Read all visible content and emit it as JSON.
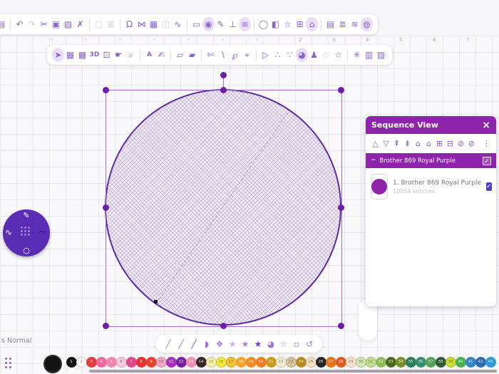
{
  "colors": {
    "accent": "#8e24aa",
    "toolbar_icon": "#8a63c9",
    "radial_bg": "#5b2db5",
    "circle_outline": "#5e2b9e",
    "selection": "#6d1fa7",
    "checkbox": "#4d3fc6"
  },
  "ruler": {
    "numbers": [
      "2",
      "3",
      "4",
      "5",
      "6",
      "7"
    ]
  },
  "status_text": "s Normal",
  "toolbar_top": {
    "items": [
      {
        "n": "save-icon",
        "g": "▤"
      },
      {
        "s": "sep"
      },
      {
        "n": "undo-icon",
        "g": "↶"
      },
      {
        "n": "redo-icon",
        "g": "↷",
        "s": "dis"
      },
      {
        "n": "cut-icon",
        "g": "✂"
      },
      {
        "n": "copy-icon",
        "g": "▣"
      },
      {
        "n": "paste-icon",
        "g": "▨"
      },
      {
        "n": "delete-icon",
        "g": "✗"
      },
      {
        "s": "sep"
      },
      {
        "n": "marquee-select-icon",
        "g": "▢",
        "s": "dis"
      },
      {
        "n": "transform-icon",
        "g": "⊞",
        "s": "dis"
      },
      {
        "s": "sep"
      },
      {
        "n": "magnet-icon",
        "g": "Ω"
      },
      {
        "n": "mirror-vertical-icon",
        "g": "⋈"
      },
      {
        "n": "machine-icon",
        "g": "▦"
      },
      {
        "n": "mirror-horizontal-icon",
        "g": "◫",
        "s": "dis"
      },
      {
        "n": "curve-icon",
        "g": "∿"
      },
      {
        "s": "sep"
      },
      {
        "n": "rectangle-icon",
        "g": "▭"
      },
      {
        "n": "reshape-icon",
        "g": "◉",
        "s": "hl"
      },
      {
        "n": "stitch-pen-icon",
        "g": "✎"
      },
      {
        "n": "pin-icon",
        "g": "⊥"
      },
      {
        "n": "stitch-params-icon",
        "g": "≡",
        "s": "hl"
      },
      {
        "s": "sep"
      },
      {
        "n": "hoop-icon",
        "g": "◯"
      },
      {
        "n": "shapes-icon",
        "g": "◧"
      },
      {
        "n": "frame-star-icon",
        "g": "☆"
      },
      {
        "n": "add-object-icon",
        "g": "⊞"
      },
      {
        "n": "lock-icon",
        "g": "⌂",
        "s": "hl"
      },
      {
        "s": "sep"
      },
      {
        "n": "design-list-icon",
        "g": "▤"
      },
      {
        "n": "properties-icon",
        "g": "≣"
      },
      {
        "n": "layers-icon",
        "g": "≋"
      },
      {
        "n": "globe-icon",
        "g": "◍",
        "s": "hl"
      }
    ]
  },
  "toolbar_tools": {
    "items": [
      {
        "n": "select-tool",
        "g": "➤",
        "s": "hl"
      },
      {
        "n": "mesh-select-tool",
        "g": "▦"
      },
      {
        "n": "lattice-select-tool",
        "g": "▩"
      },
      {
        "n": "view-3d-tool",
        "g": "3D",
        "c": "txt"
      },
      {
        "n": "monitor-tool",
        "g": "⊡"
      },
      {
        "n": "pan-tool",
        "g": "☛"
      },
      {
        "n": "zoom-tool",
        "g": "⌕"
      },
      {
        "s": "sep"
      },
      {
        "n": "lettering-tool",
        "g": "A",
        "c": "txt"
      },
      {
        "n": "monogram-tool",
        "g": "✍"
      },
      {
        "s": "sep"
      },
      {
        "n": "import-artwork-tool",
        "g": "▱"
      },
      {
        "n": "export-artwork-tool",
        "g": "▰"
      },
      {
        "s": "sep"
      },
      {
        "n": "knife-tool",
        "g": "✄"
      },
      {
        "n": "line-tool",
        "g": "∖"
      },
      {
        "n": "lasso-tool",
        "g": "℘"
      },
      {
        "n": "node-edit-tool",
        "g": "⌖"
      },
      {
        "s": "sep"
      },
      {
        "n": "run-tool",
        "g": "▷"
      },
      {
        "n": "stitch-nodes-tool",
        "g": "∴"
      },
      {
        "n": "outline-nodes-tool",
        "g": "∵"
      },
      {
        "n": "fill-tool",
        "g": "◕",
        "s": "hl"
      },
      {
        "n": "figure-tool",
        "g": "♟"
      },
      {
        "n": "shape-tool",
        "g": "◇",
        "s": "dis"
      },
      {
        "n": "star-tool",
        "g": "☆"
      },
      {
        "s": "sep"
      },
      {
        "n": "magic-wand-tool",
        "g": "✳"
      },
      {
        "n": "image-tool",
        "g": "▥"
      },
      {
        "n": "image-edit-tool",
        "g": "▨"
      }
    ]
  },
  "sequence_panel": {
    "title": "Sequence View",
    "close_glyph": "×",
    "toolbar": [
      {
        "n": "move-up-icon",
        "g": "△",
        "s": "dis"
      },
      {
        "n": "move-down-icon",
        "g": "▽",
        "s": "dis"
      },
      {
        "n": "move-first-icon",
        "g": "⇞",
        "s": "dis"
      },
      {
        "n": "move-last-icon",
        "g": "⇟",
        "s": "dis"
      },
      {
        "n": "lock-item-icon",
        "g": "⌂"
      },
      {
        "n": "unlock-item-icon",
        "g": "⌂",
        "c": "tilt"
      },
      {
        "n": "group-icon",
        "g": "⊞"
      },
      {
        "n": "ungroup-icon",
        "g": "⊟"
      },
      {
        "n": "hide-icon",
        "g": "⊘",
        "s": "dis"
      },
      {
        "n": "show-icon",
        "g": "⊘",
        "s": "dis"
      },
      {
        "n": "menu-kebab-icon",
        "g": "⋮",
        "c": "dark"
      }
    ],
    "group": {
      "collapse_glyph": "−",
      "label": "Brother 869 Royal Purple",
      "check_glyph": "✓"
    },
    "item": {
      "label": "1. Brother 869 Royal Purple",
      "sublabel": "10054 stitches",
      "swatch_color": "#8e24aa",
      "check_glyph": "✓"
    }
  },
  "radial_menu": {
    "pen_glyph": "✎",
    "wave_glyph": "∿",
    "curve_glyph": "∼",
    "circle_glyph": "○"
  },
  "draw_toolbar": {
    "items": [
      {
        "n": "line-thin-tool",
        "g": "╱"
      },
      {
        "n": "line-medium-tool",
        "g": "╱",
        "c": "w2"
      },
      {
        "n": "line-thick-tool",
        "g": "╱",
        "c": "w3"
      },
      {
        "n": "petal-tool",
        "g": "◗"
      },
      {
        "n": "petal-node-tool",
        "g": "❖"
      },
      {
        "n": "star-light-tool",
        "g": "★",
        "c": "st1"
      },
      {
        "n": "star-mid-tool",
        "g": "★",
        "c": "st2"
      },
      {
        "n": "star-dark-tool",
        "g": "★",
        "c": "st3"
      },
      {
        "n": "leaf-tool",
        "g": "◕"
      },
      {
        "n": "star-outline-tool",
        "g": "☆"
      },
      {
        "n": "frame-tool",
        "g": "▫",
        "s": "dis"
      },
      {
        "n": "rotate-tool",
        "g": "↺",
        "s": "dis"
      }
    ]
  },
  "palette": {
    "selected_color": "#141414",
    "colors": [
      {
        "n": "1",
        "hex": "#141414"
      },
      {
        "n": "2",
        "hex": "#f8f8f8"
      },
      {
        "n": "3",
        "hex": "#e23b3b"
      },
      {
        "n": "4",
        "hex": "#f0699c"
      },
      {
        "n": "5",
        "hex": "#ee86ae"
      },
      {
        "n": "6",
        "hex": "#f9ccdb"
      },
      {
        "n": "7",
        "hex": "#e0468c"
      },
      {
        "n": "8",
        "hex": "#e23333"
      },
      {
        "n": "9",
        "hex": "#e8432f"
      },
      {
        "n": "10",
        "hex": "#f3a8c4"
      },
      {
        "n": "11",
        "hex": "#a833b9"
      },
      {
        "n": "12",
        "hex": "#7b1fa2"
      },
      {
        "n": "13",
        "hex": "#ef8fb3"
      },
      {
        "n": "14",
        "hex": "#35292a"
      },
      {
        "n": "15",
        "hex": "#f7f0a8"
      },
      {
        "n": "16",
        "hex": "#f6e93e"
      },
      {
        "n": "17",
        "hex": "#f4c430"
      },
      {
        "n": "18",
        "hex": "#f2a32c"
      },
      {
        "n": "19",
        "hex": "#ef8c26"
      },
      {
        "n": "20",
        "hex": "#ed7d20"
      },
      {
        "n": "21",
        "hex": "#c79b22"
      },
      {
        "n": "22",
        "hex": "#f5ecd4"
      },
      {
        "n": "23",
        "hex": "#d9c49e"
      },
      {
        "n": "24",
        "hex": "#b98a24"
      },
      {
        "n": "25",
        "hex": "#f2e2c0"
      },
      {
        "n": "26",
        "hex": "#242424"
      },
      {
        "n": "27",
        "hex": "#e5731d"
      },
      {
        "n": "28",
        "hex": "#dd5c26"
      },
      {
        "n": "29",
        "hex": "#f8e2cd"
      },
      {
        "n": "30",
        "hex": "#d5e6b0"
      },
      {
        "n": "31",
        "hex": "#c2db92"
      },
      {
        "n": "32",
        "hex": "#8fbc5a"
      },
      {
        "n": "33",
        "hex": "#4a6b1f"
      },
      {
        "n": "34",
        "hex": "#7a8c2e"
      },
      {
        "n": "35",
        "hex": "#2e7d5b"
      },
      {
        "n": "36",
        "hex": "#3a8c6f"
      },
      {
        "n": "37",
        "hex": "#58a05a"
      },
      {
        "n": "38",
        "hex": "#2e5d34"
      },
      {
        "n": "39",
        "hex": "#cddc39"
      },
      {
        "n": "40",
        "hex": "#4caf50"
      },
      {
        "n": "41",
        "hex": "#3584c7"
      },
      {
        "n": "42",
        "hex": "#2b6cb0"
      },
      {
        "n": "43",
        "hex": "#2f9bd6"
      }
    ]
  }
}
